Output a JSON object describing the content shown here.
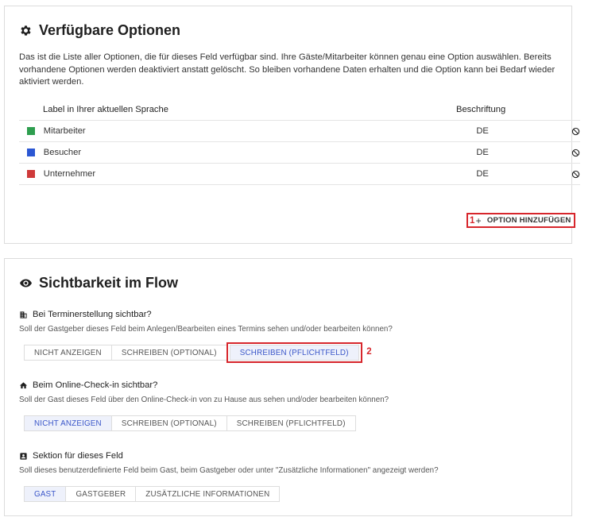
{
  "options": {
    "title": "Verfügbare Optionen",
    "description": "Das ist die Liste aller Optionen, die für dieses Feld verfügbar sind. Ihre Gäste/Mitarbeiter können genau eine Option auswählen. Bereits vorhandene Optionen werden deaktiviert anstatt gelöscht. So bleiben vorhandene Daten erhalten und die Option kann bei Bedarf wieder aktiviert werden.",
    "col_label": "Label in Ihrer aktuellen Sprache",
    "col_desc": "Beschriftung",
    "rows": [
      {
        "label": "Mitarbeiter",
        "lang": "DE",
        "color": "#2e9e4f"
      },
      {
        "label": "Besucher",
        "lang": "DE",
        "color": "#2b57d3"
      },
      {
        "label": "Unternehmer",
        "lang": "DE",
        "color": "#cf3a3a"
      }
    ],
    "add_badge": "1",
    "add_plus": "+",
    "add_label": "OPTION HINZUFÜGEN"
  },
  "visibility": {
    "title": "Sichtbarkeit im Flow",
    "sections": [
      {
        "heading": "Bei Terminerstellung sichtbar?",
        "hint": "Soll der Gastgeber dieses Feld beim Anlegen/Bearbeiten eines Termins sehen und/oder bearbeiten können?",
        "options": [
          "NICHT ANZEIGEN",
          "SCHREIBEN (OPTIONAL)",
          "SCHREIBEN (PFLICHTFELD)"
        ],
        "selected": 2,
        "badge": "2"
      },
      {
        "heading": "Beim Online-Check-in sichtbar?",
        "hint": "Soll der Gast dieses Feld über den Online-Check-in von zu Hause aus sehen und/oder bearbeiten können?",
        "options": [
          "NICHT ANZEIGEN",
          "SCHREIBEN (OPTIONAL)",
          "SCHREIBEN (PFLICHTFELD)"
        ],
        "selected": 0
      },
      {
        "heading": "Sektion für dieses Feld",
        "hint": "Soll dieses benutzerdefinierte Feld beim Gast, beim Gastgeber oder unter \"Zusätzliche Informationen\" angezeigt werden?",
        "options": [
          "GAST",
          "GASTGEBER",
          "ZUSÄTZLICHE INFORMATIONEN"
        ],
        "selected": 0
      }
    ]
  }
}
